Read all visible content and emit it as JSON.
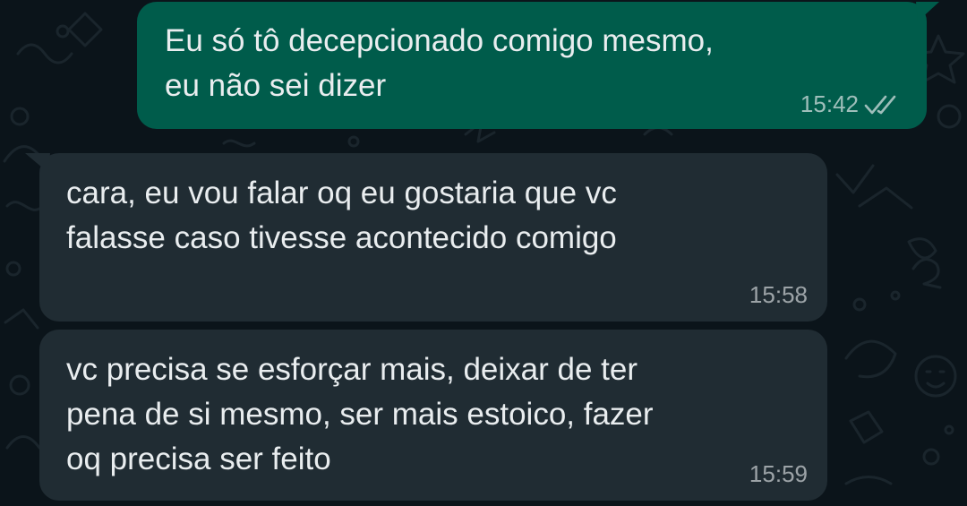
{
  "conversation": {
    "messages": [
      {
        "direction": "outgoing",
        "text": "Eu só tô decepcionado comigo mesmo,\neu não sei dizer",
        "time": "15:42",
        "status_icon": "double-check-read-icon"
      },
      {
        "direction": "incoming",
        "text": "cara, eu vou falar oq eu gostaria que vc\nfalasse caso tivesse acontecido comigo",
        "time": "15:58"
      },
      {
        "direction": "incoming",
        "text": "vc precisa se esforçar mais, deixar de ter\npena de si mesmo, ser mais estoico, fazer\noq precisa ser feito",
        "time": "15:59"
      }
    ]
  },
  "colors": {
    "background": "#0b141a",
    "outgoing_bubble": "#005c4b",
    "incoming_bubble": "#202c33",
    "text": "#e9edef"
  }
}
